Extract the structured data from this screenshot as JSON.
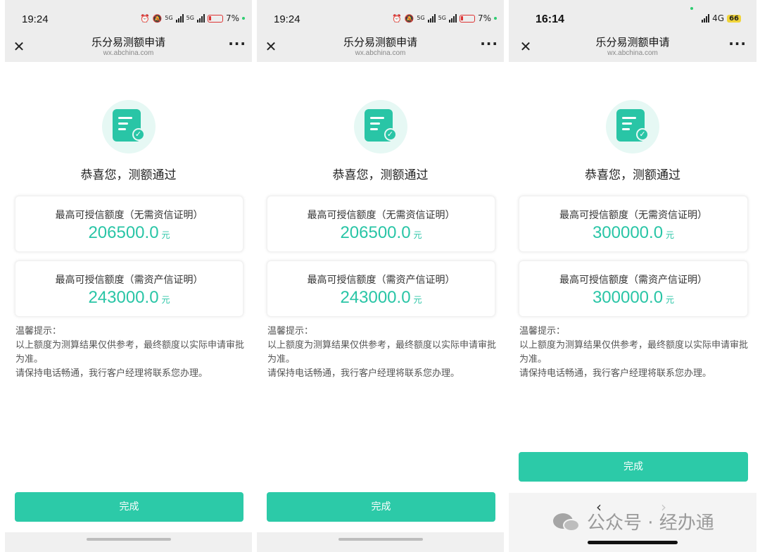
{
  "panels": [
    {
      "status": {
        "time": "19:24",
        "net1": "5G",
        "net2": "5G",
        "battery": "7%"
      },
      "nav": {
        "close": "✕",
        "title": "乐分易测额申请",
        "subtitle": "wx.abchina.com",
        "more": "···"
      },
      "success_text": "恭喜您，测额通过",
      "cards": [
        {
          "label": "最高可授信额度（无需资信证明）",
          "amount": "206500.0",
          "unit": "元"
        },
        {
          "label": "最高可授信额度（需资产信证明）",
          "amount": "243000.0",
          "unit": "元"
        }
      ],
      "tips": {
        "title": "温馨提示：",
        "line1": "以上额度为测算结果仅供参考，最终额度以实际申请审批为准。",
        "line2": "请保持电话畅通，我行客户经理将联系您办理。"
      },
      "button": "完成"
    },
    {
      "status": {
        "time": "19:24",
        "net1": "5G",
        "net2": "5G",
        "battery": "7%"
      },
      "nav": {
        "close": "✕",
        "title": "乐分易测额申请",
        "subtitle": "wx.abchina.com",
        "more": "···"
      },
      "success_text": "恭喜您，测额通过",
      "cards": [
        {
          "label": "最高可授信额度（无需资信证明）",
          "amount": "206500.0",
          "unit": "元"
        },
        {
          "label": "最高可授信额度（需资产信证明）",
          "amount": "243000.0",
          "unit": "元"
        }
      ],
      "tips": {
        "title": "温馨提示：",
        "line1": "以上额度为测算结果仅供参考，最终额度以实际申请审批为准。",
        "line2": "请保持电话畅通，我行客户经理将联系您办理。"
      },
      "button": "完成"
    },
    {
      "status": {
        "time": "16:14",
        "network": "4G",
        "battery": "66"
      },
      "nav": {
        "close": "✕",
        "title": "乐分易测额申请",
        "subtitle": "wx.abchina.com",
        "more": "···"
      },
      "success_text": "恭喜您，测额通过",
      "cards": [
        {
          "label": "最高可授信额度（无需资信证明）",
          "amount": "300000.0",
          "unit": "元"
        },
        {
          "label": "最高可授信额度（需资产信证明）",
          "amount": "300000.0",
          "unit": "元"
        }
      ],
      "tips": {
        "title": "温馨提示：",
        "line1": "以上额度为测算结果仅供参考，最终额度以实际申请审批为准。",
        "line2": "请保持电话畅通，我行客户经理将联系您办理。"
      },
      "button": "完成",
      "browser_nav": {
        "back": "‹",
        "forward": "›"
      }
    }
  ],
  "watermark": {
    "text": "公众号 · 经办通"
  },
  "colors": {
    "accent": "#2ccaa8",
    "amount": "#29c5a6",
    "bar": "#ededed"
  }
}
